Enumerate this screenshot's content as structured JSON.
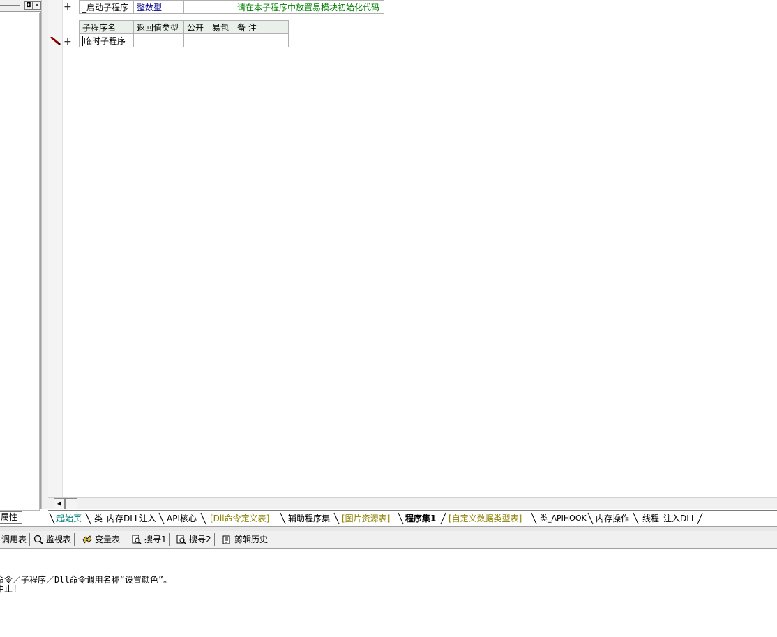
{
  "left_panel": {
    "restore_glyph": "◘",
    "close_glyph": "×",
    "tab_label": "属性"
  },
  "editor": {
    "row_plus": "+",
    "top_row": {
      "name": "_启动子程序",
      "return_type": "整数型",
      "public": "",
      "package": "",
      "remark": "请在本子程序中放置易模块初始化代码"
    },
    "sub_table": {
      "headers": [
        "子程序名",
        "返回值类型",
        "公开",
        "易包",
        "备 注"
      ],
      "row": {
        "name": "临时子程序",
        "return_type": "",
        "public": "",
        "package": "",
        "remark": ""
      }
    }
  },
  "scrollbar": {
    "left_arrow": "◀"
  },
  "file_tabs": [
    {
      "label": "起始页",
      "color": "teal"
    },
    {
      "label": "类_内存DLL注入",
      "color": "black"
    },
    {
      "label": "API核心",
      "color": "black"
    },
    {
      "label": "[Dll命令定义表]",
      "color": "olive"
    },
    {
      "label": "辅助程序集",
      "color": "black"
    },
    {
      "label": "[图片资源表]",
      "color": "olive"
    },
    {
      "label": "程序集1",
      "color": "black",
      "active": true
    },
    {
      "label": "[自定义数据类型表]",
      "color": "olive"
    },
    {
      "label": "类_APIHOOK",
      "color": "black"
    },
    {
      "label": "内存操作",
      "color": "black"
    },
    {
      "label": "线程_注入DLL",
      "color": "black"
    }
  ],
  "bottom_tabs": {
    "call_table": "调用表",
    "watch": "监视表",
    "variables": "变量表",
    "search1": "搜寻1",
    "search2": "搜寻2",
    "clip_history": "剪辑历史"
  },
  "output": {
    "line1": "命令／子程序／Dll命令调用名称“设置颜色”。",
    "line2": "中止!"
  }
}
